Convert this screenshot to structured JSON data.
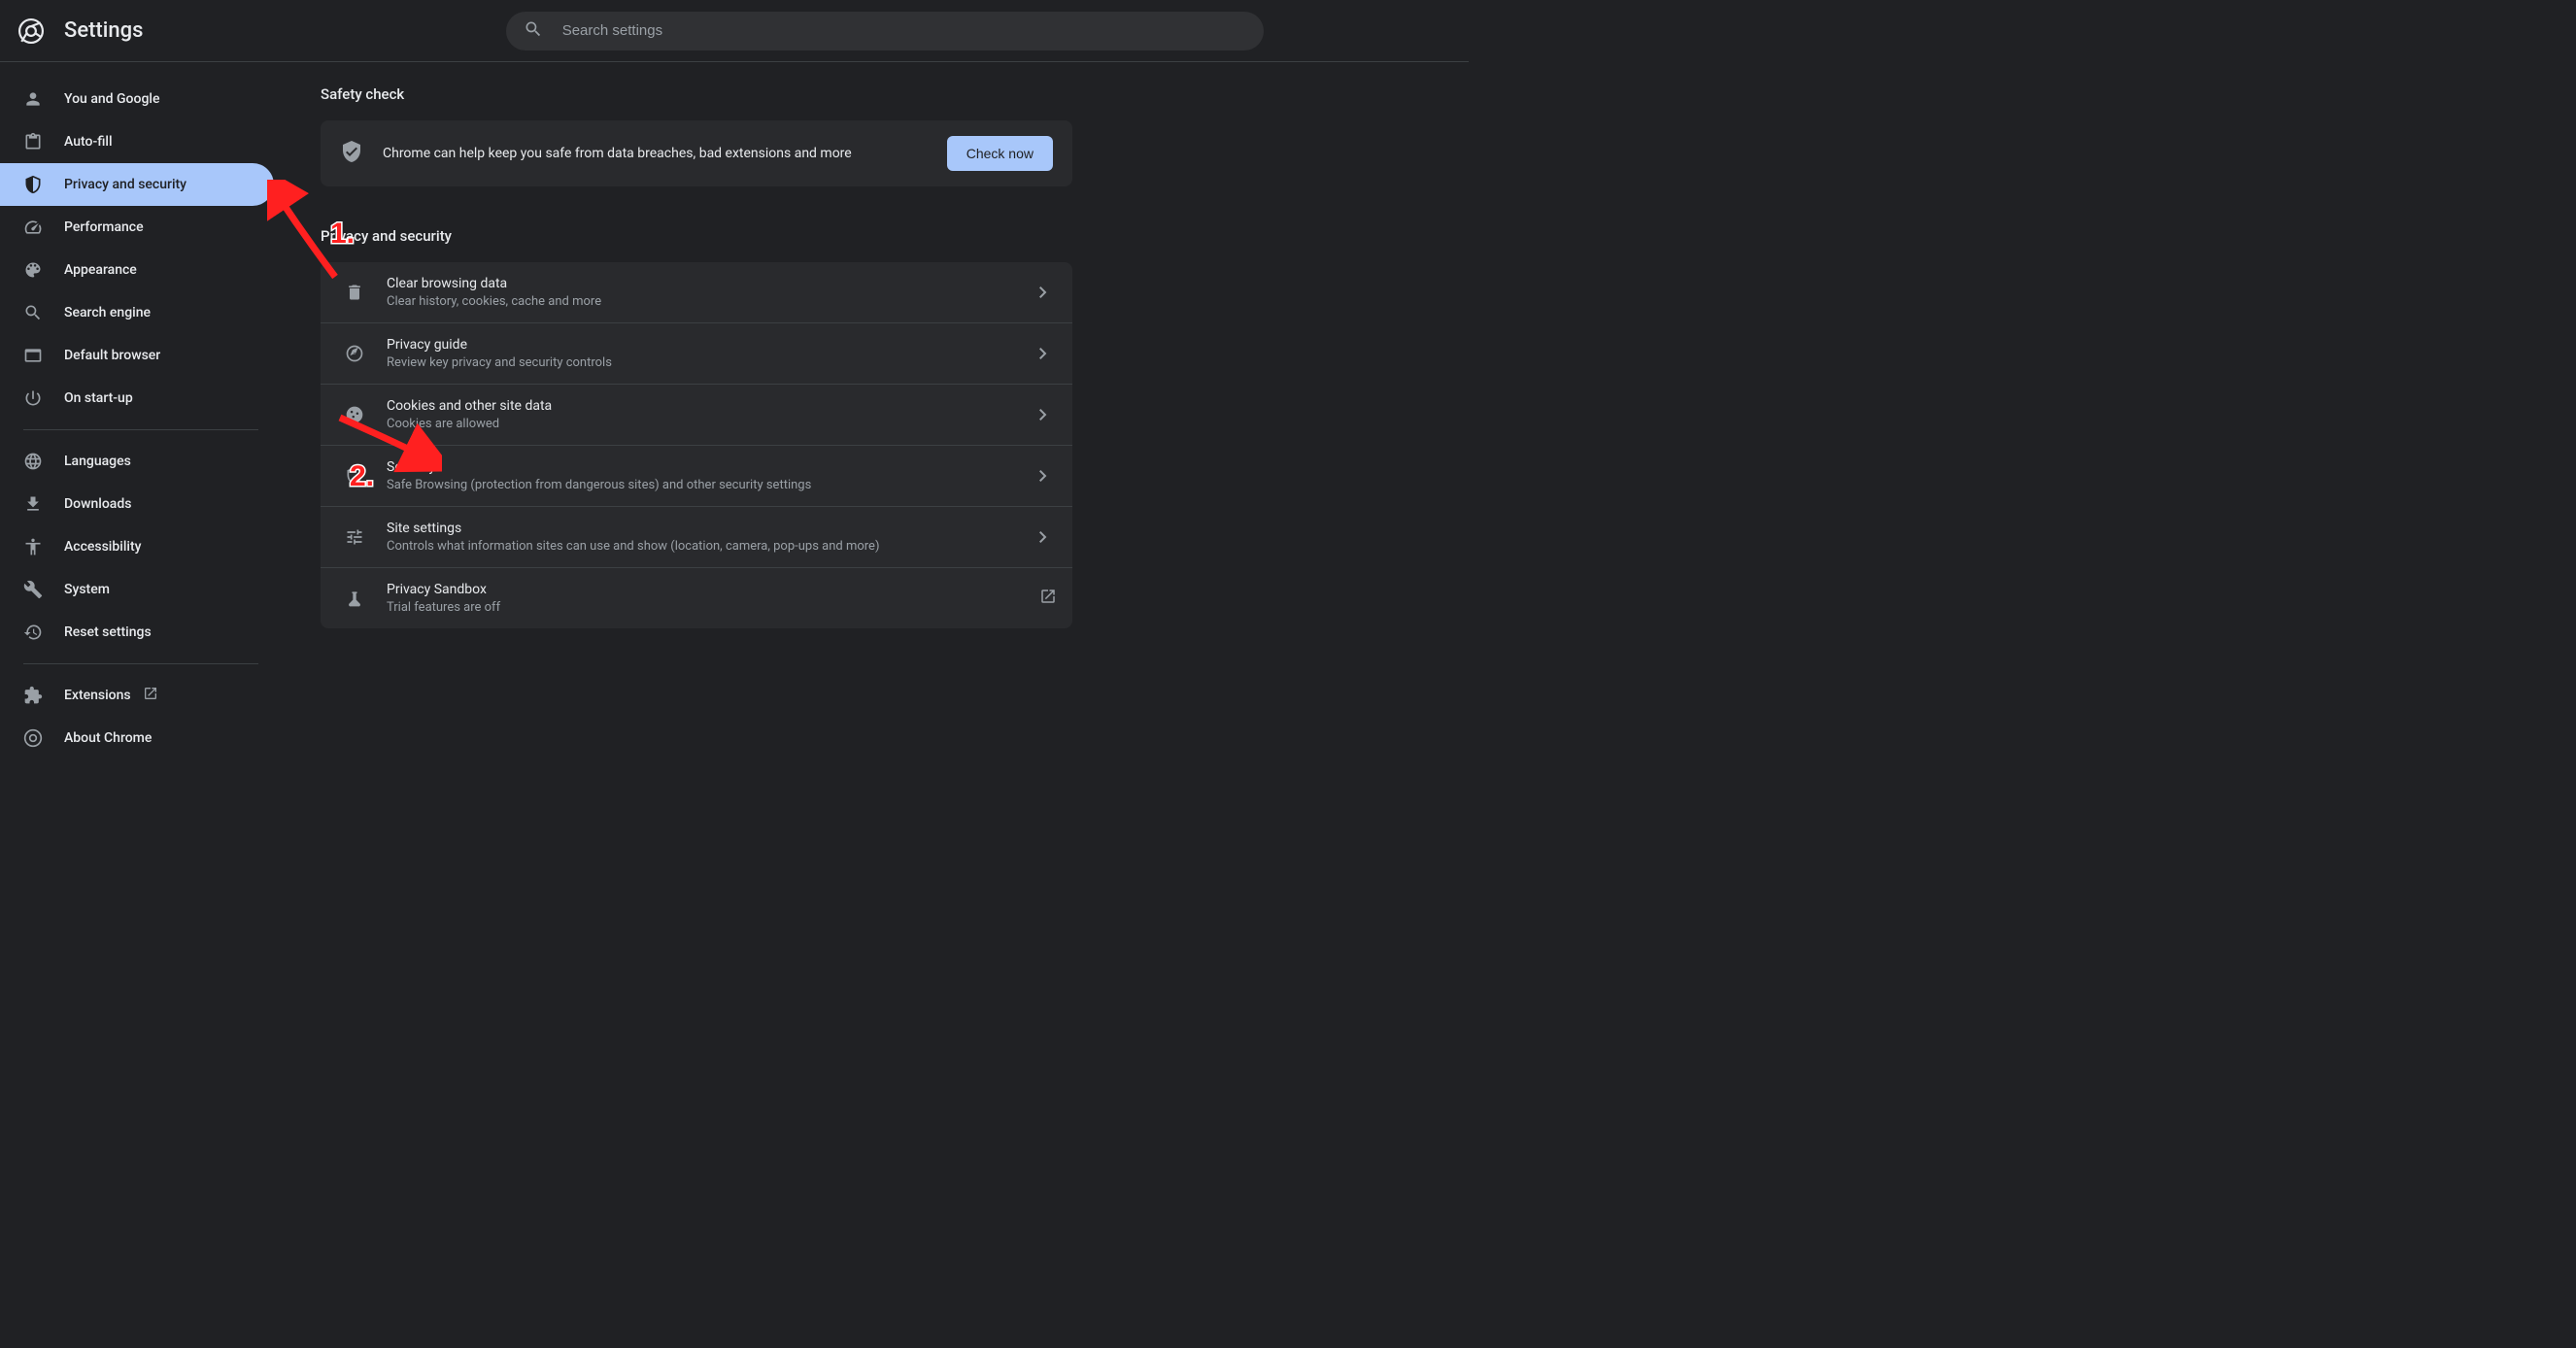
{
  "header": {
    "title": "Settings"
  },
  "search": {
    "placeholder": "Search settings"
  },
  "sidebar": {
    "groups": [
      [
        {
          "icon": "person",
          "label": "You and Google"
        },
        {
          "icon": "clipboard",
          "label": "Auto-fill"
        },
        {
          "icon": "shield",
          "label": "Privacy and security",
          "active": true
        },
        {
          "icon": "speedometer",
          "label": "Performance"
        },
        {
          "icon": "palette",
          "label": "Appearance"
        },
        {
          "icon": "search",
          "label": "Search engine"
        },
        {
          "icon": "browser",
          "label": "Default browser"
        },
        {
          "icon": "power",
          "label": "On start-up"
        }
      ],
      [
        {
          "icon": "globe",
          "label": "Languages"
        },
        {
          "icon": "download",
          "label": "Downloads"
        },
        {
          "icon": "accessibility",
          "label": "Accessibility"
        },
        {
          "icon": "wrench",
          "label": "System"
        },
        {
          "icon": "history",
          "label": "Reset settings"
        }
      ],
      [
        {
          "icon": "puzzle",
          "label": "Extensions",
          "external": true
        },
        {
          "icon": "chrome",
          "label": "About Chrome"
        }
      ]
    ]
  },
  "content": {
    "safety_check": {
      "title": "Safety check",
      "message": "Chrome can help keep you safe from data breaches, bad extensions and more",
      "button": "Check now"
    },
    "privacy": {
      "title": "Privacy and security",
      "items": [
        {
          "icon": "trash",
          "title": "Clear browsing data",
          "subtitle": "Clear history, cookies, cache and more",
          "arrow": "chevron"
        },
        {
          "icon": "compass",
          "title": "Privacy guide",
          "subtitle": "Review key privacy and security controls",
          "arrow": "chevron"
        },
        {
          "icon": "cookie",
          "title": "Cookies and other site data",
          "subtitle": "Cookies are allowed",
          "arrow": "chevron"
        },
        {
          "icon": "shield-outline",
          "title": "Security",
          "subtitle": "Safe Browsing (protection from dangerous sites) and other security settings",
          "arrow": "chevron"
        },
        {
          "icon": "tune",
          "title": "Site settings",
          "subtitle": "Controls what information sites can use and show (location, camera, pop-ups and more)",
          "arrow": "chevron"
        },
        {
          "icon": "flask",
          "title": "Privacy Sandbox",
          "subtitle": "Trial features are off",
          "arrow": "external"
        }
      ]
    }
  },
  "annotations": {
    "one": "1.",
    "two": "2."
  }
}
